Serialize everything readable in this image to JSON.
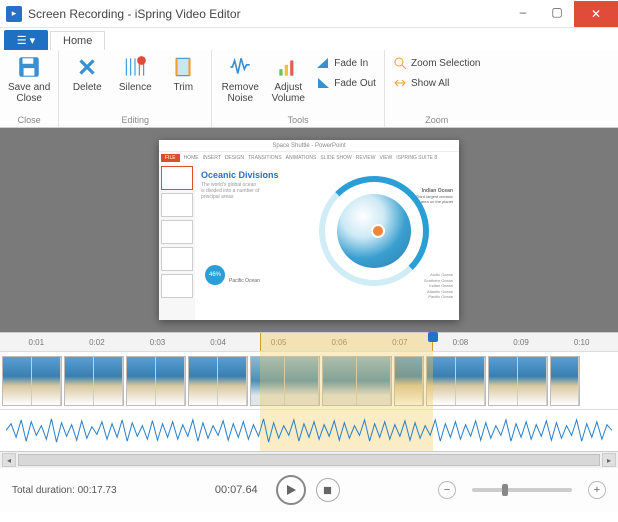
{
  "window": {
    "title": "Screen Recording - iSpring Video Editor",
    "minimize": "–",
    "maximize": "▢",
    "close": "✕"
  },
  "tabs": {
    "file": "☰ ▾",
    "home": "Home"
  },
  "ribbon": {
    "close": {
      "save_close": "Save and\nClose",
      "label": "Close"
    },
    "editing": {
      "delete": "Delete",
      "silence": "Silence",
      "trim": "Trim",
      "label": "Editing"
    },
    "tools": {
      "remove_noise": "Remove\nNoise",
      "adjust_volume": "Adjust\nVolume",
      "fade_in": "Fade In",
      "fade_out": "Fade Out",
      "label": "Tools"
    },
    "zoom": {
      "zoom_selection": "Zoom Selection",
      "show_all": "Show All",
      "label": "Zoom"
    }
  },
  "preview": {
    "ppt_title": "Space Shuttle - PowerPoint",
    "ppt_tabs": [
      "FILE",
      "HOME",
      "INSERT",
      "DESIGN",
      "TRANSITIONS",
      "ANIMATIONS",
      "SLIDE SHOW",
      "REVIEW",
      "VIEW",
      "ISPRING SUITE 8"
    ],
    "slide_title": "Oceanic Divisions",
    "slide_sub": "The world's global ocean is divided into a number of principal areas",
    "pacific_pct": "46%",
    "pacific_label": "Pacific Ocean",
    "indian_label": "Indian Ocean",
    "indian_sub": "Third largest oceanic area on the planet",
    "legend": [
      "Arctic Ocean",
      "Southern Ocean",
      "Indian Ocean",
      "Atlantic Ocean",
      "Pacific Ocean"
    ]
  },
  "timeline": {
    "ticks": [
      "0:01",
      "0:02",
      "0:03",
      "0:04",
      "0:05",
      "0:06",
      "0:07",
      "0:08",
      "0:09",
      "0:10"
    ],
    "selection_start_pct": 42,
    "selection_end_pct": 70,
    "playhead_pct": 70
  },
  "controls": {
    "total_label": "Total duration:",
    "total_value": "00:17.73",
    "current_time": "00:07.64",
    "zoom_out": "−",
    "zoom_in": "+"
  }
}
